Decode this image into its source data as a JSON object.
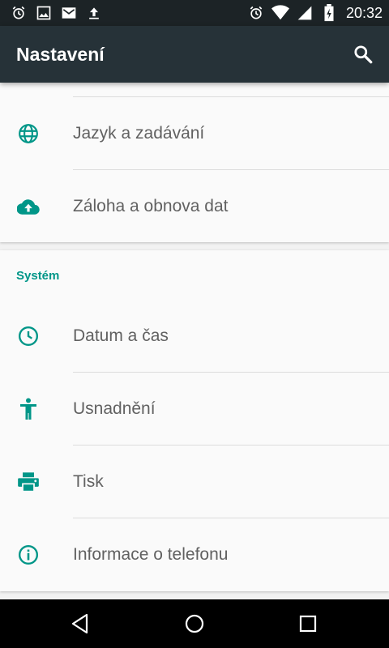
{
  "status_bar": {
    "time": "20:32",
    "left_icons": [
      "alarm-icon",
      "image-icon",
      "gmail-icon",
      "upload-icon"
    ],
    "right_icons": [
      "alarm-icon",
      "wifi-icon",
      "signal-icon",
      "battery-charging-icon"
    ]
  },
  "app_bar": {
    "title": "Nastavení",
    "search_icon": "search-icon"
  },
  "card_personal": {
    "items": [
      {
        "label": "Jazyk a zadávání",
        "icon": "globe-icon"
      },
      {
        "label": "Záloha a obnova dat",
        "icon": "cloud-upload-icon"
      }
    ]
  },
  "card_system": {
    "section_title": "Systém",
    "items": [
      {
        "label": "Datum a čas",
        "icon": "clock-icon"
      },
      {
        "label": "Usnadnění",
        "icon": "accessibility-icon"
      },
      {
        "label": "Tisk",
        "icon": "printer-icon"
      },
      {
        "label": "Informace o telefonu",
        "icon": "info-icon"
      }
    ]
  },
  "nav_bar": {
    "buttons": [
      "back-icon",
      "home-icon",
      "recents-icon"
    ]
  },
  "colors": {
    "accent": "#009688",
    "app_bar": "#263238",
    "status_bar": "#1c2326",
    "background": "#f2f2f2",
    "card": "#fafafa",
    "text_secondary": "#616161"
  }
}
